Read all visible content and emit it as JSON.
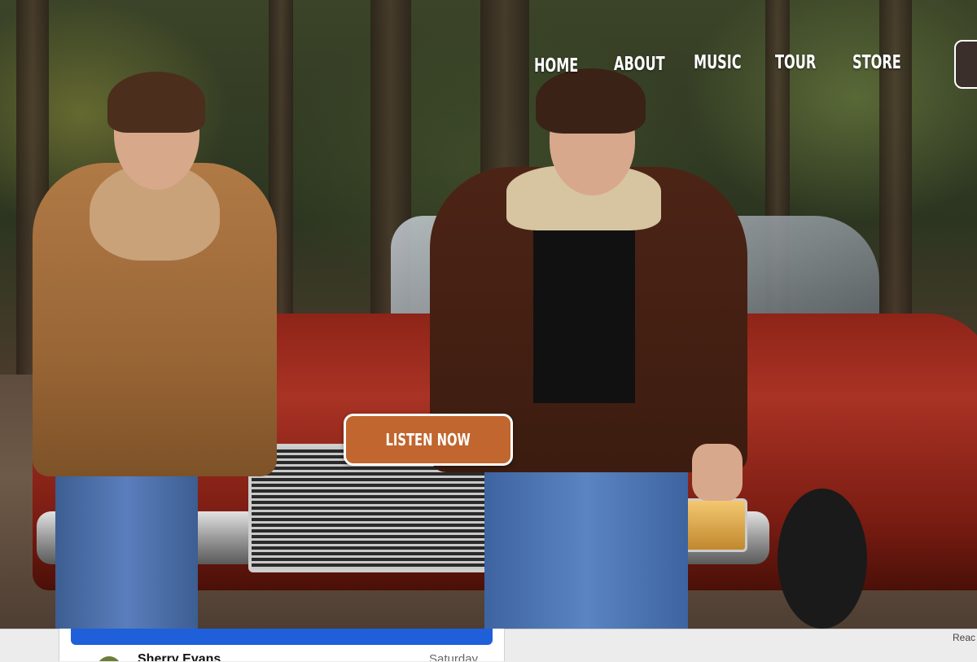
{
  "nav": {
    "items": [
      {
        "label": "HOME"
      },
      {
        "label": "ABOUT"
      },
      {
        "label": "MUSIC"
      },
      {
        "label": "TOUR"
      },
      {
        "label": "STORE"
      }
    ]
  },
  "hero": {
    "cta_label": "LISTEN NOW"
  },
  "bottom_panel": {
    "name": "Sherry Evans",
    "day": "Saturday"
  },
  "corner_text": "Reac",
  "colors": {
    "cta_background": "#c0662e",
    "panel_bar": "#1f5fd9"
  }
}
